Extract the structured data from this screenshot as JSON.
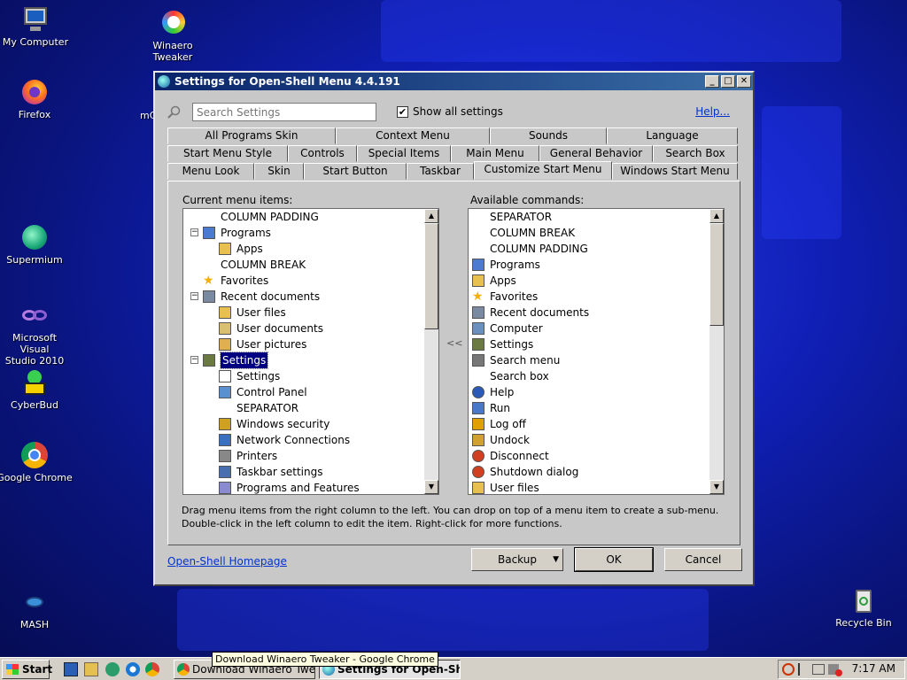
{
  "desktop": {
    "icons": [
      {
        "label": "My Computer",
        "icon": "computer-icon"
      },
      {
        "label": "Winaero\nTweaker",
        "icon": "winaero-icon"
      },
      {
        "label": "Firefox",
        "icon": "firefox-icon"
      },
      {
        "label": "mC",
        "icon": "partial-label"
      },
      {
        "label": "Supermium",
        "icon": "supermium-icon"
      },
      {
        "label": "Microsoft Visual\nStudio 2010",
        "icon": "visual-studio-icon"
      },
      {
        "label": "CyberBud",
        "icon": "cyberbud-icon"
      },
      {
        "label": "Google Chrome",
        "icon": "chrome-icon"
      },
      {
        "label": "MASH",
        "icon": "mash-icon"
      },
      {
        "label": "Recycle Bin",
        "icon": "recycle-bin-icon"
      }
    ]
  },
  "window": {
    "title": "Settings for Open-Shell Menu 4.4.191",
    "buttons": {
      "minimize": "_",
      "maximize": "□",
      "close": "✕"
    },
    "search": {
      "placeholder": "Search Settings"
    },
    "show_all_settings": {
      "label": "Show all settings",
      "checked": true,
      "mark": "✔"
    },
    "help_link": "Help...",
    "tabs_row1": [
      "All Programs Skin",
      "Context Menu",
      "Sounds",
      "Language"
    ],
    "tabs_row2": [
      "Start Menu Style",
      "Controls",
      "Special Items",
      "Main Menu",
      "General Behavior",
      "Search Box"
    ],
    "tabs_row3": [
      "Menu Look",
      "Skin",
      "Start Button",
      "Taskbar",
      "Customize Start Menu",
      "Windows Start Menu"
    ],
    "active_tab": "Customize Start Menu",
    "current_label": "Current menu items:",
    "available_label": "Available commands:",
    "move_arrows": "<<",
    "current_items": [
      {
        "text": "COLUMN PADDING",
        "level": 0,
        "icon": "none"
      },
      {
        "text": "Programs",
        "level": 0,
        "icon": "programs-icon",
        "expander": "−"
      },
      {
        "text": "Apps",
        "level": 1,
        "icon": "apps-icon"
      },
      {
        "text": "COLUMN BREAK",
        "level": 0,
        "icon": "none"
      },
      {
        "text": "Favorites",
        "level": 0,
        "icon": "star-icon"
      },
      {
        "text": "Recent documents",
        "level": 0,
        "icon": "recent-icon",
        "expander": "−"
      },
      {
        "text": "User files",
        "level": 1,
        "icon": "folder-icon"
      },
      {
        "text": "User documents",
        "level": 1,
        "icon": "documents-icon"
      },
      {
        "text": "User pictures",
        "level": 1,
        "icon": "pictures-icon"
      },
      {
        "text": "Settings",
        "level": 0,
        "icon": "settings-icon",
        "expander": "−",
        "selected": true
      },
      {
        "text": "Settings",
        "level": 1,
        "icon": "page-icon"
      },
      {
        "text": "Control Panel",
        "level": 1,
        "icon": "control-panel-icon"
      },
      {
        "text": "SEPARATOR",
        "level": 1,
        "icon": "none"
      },
      {
        "text": "Windows security",
        "level": 1,
        "icon": "lock-icon"
      },
      {
        "text": "Network Connections",
        "level": 1,
        "icon": "network-icon"
      },
      {
        "text": "Printers",
        "level": 1,
        "icon": "printer-icon"
      },
      {
        "text": "Taskbar settings",
        "level": 1,
        "icon": "taskbar-icon"
      },
      {
        "text": "Programs and Features",
        "level": 1,
        "icon": "programs-features-icon"
      }
    ],
    "available_items": [
      {
        "text": "SEPARATOR",
        "icon": "none"
      },
      {
        "text": "COLUMN BREAK",
        "icon": "none"
      },
      {
        "text": "COLUMN PADDING",
        "icon": "none"
      },
      {
        "text": "Programs",
        "icon": "programs-icon"
      },
      {
        "text": "Apps",
        "icon": "apps-icon"
      },
      {
        "text": "Favorites",
        "icon": "star-icon"
      },
      {
        "text": "Recent documents",
        "icon": "recent-icon"
      },
      {
        "text": "Computer",
        "icon": "computer-icon"
      },
      {
        "text": "Settings",
        "icon": "settings-icon"
      },
      {
        "text": "Search menu",
        "icon": "search-icon"
      },
      {
        "text": "Search box",
        "icon": "none"
      },
      {
        "text": "Help",
        "icon": "help-icon"
      },
      {
        "text": "Run",
        "icon": "run-icon"
      },
      {
        "text": "Log off",
        "icon": "key-icon"
      },
      {
        "text": "Undock",
        "icon": "undock-icon"
      },
      {
        "text": "Disconnect",
        "icon": "power-icon"
      },
      {
        "text": "Shutdown dialog",
        "icon": "shutdown-icon"
      },
      {
        "text": "User files",
        "icon": "folder-icon"
      }
    ],
    "hint_line1": "Drag menu items from the right column to the left. You can drop on top of a menu item to create a sub-menu.",
    "hint_line2": "Double-click in the left column to edit the item. Right-click for more functions.",
    "homepage_link": "Open-Shell Homepage",
    "backup_button": "Backup",
    "ok_button": "OK",
    "cancel_button": "Cancel"
  },
  "taskbar": {
    "start": "Start",
    "tasks": [
      "Download Winaero Twea...",
      "Settings for Open-She..."
    ],
    "tooltip": "Download Winaero Tweaker - Google Chrome",
    "clock": "7:17 AM"
  }
}
